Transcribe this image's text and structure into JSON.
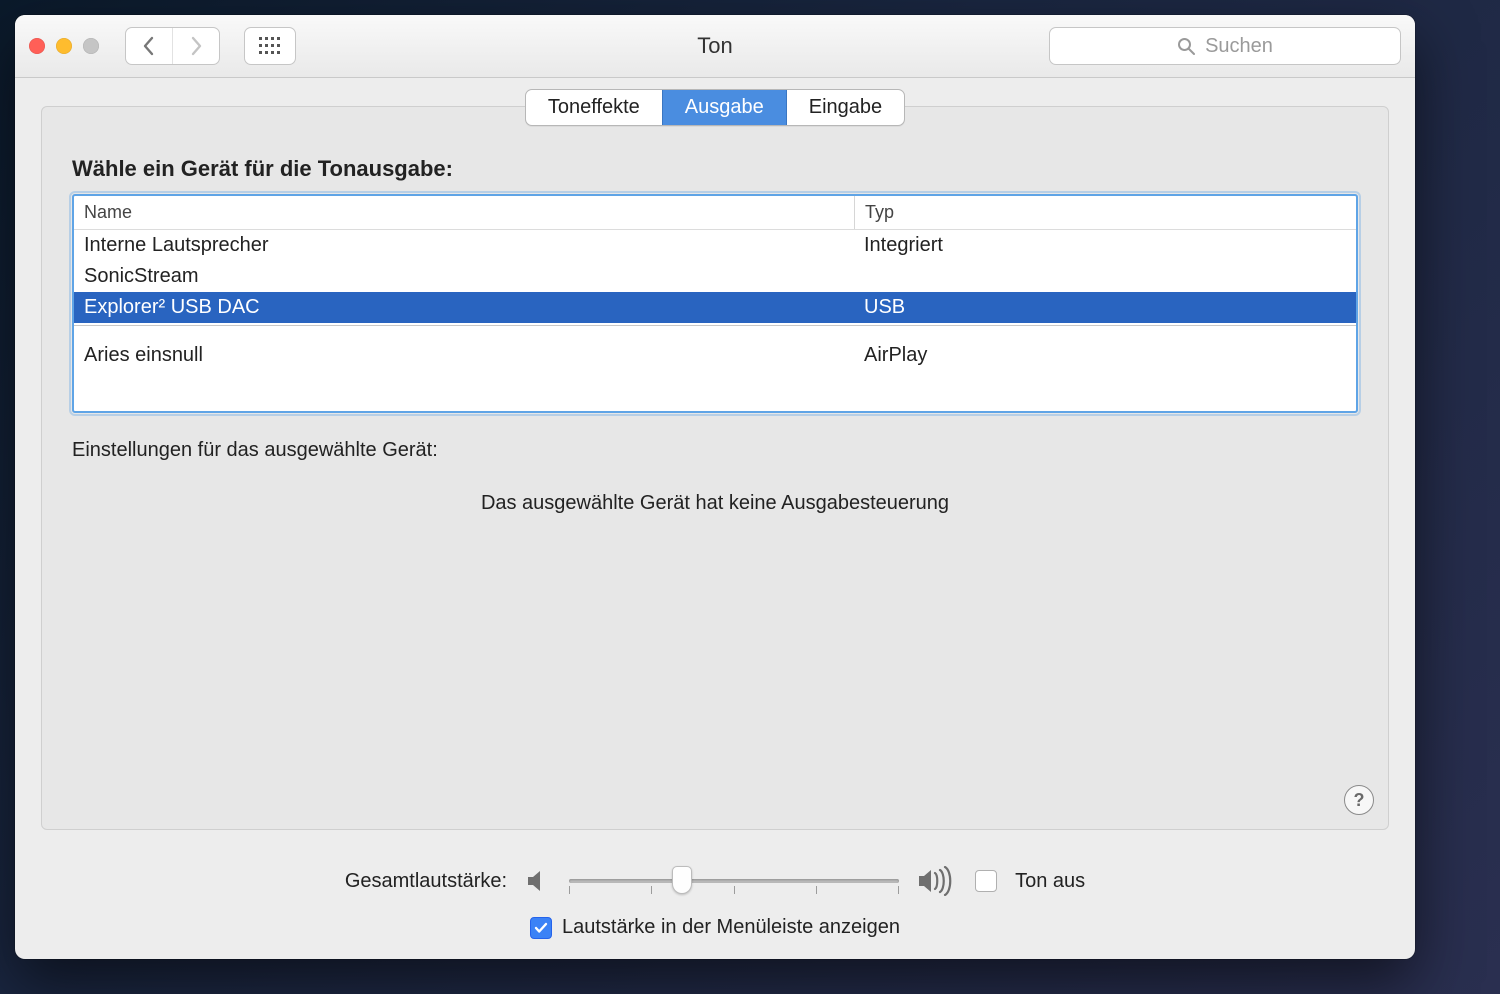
{
  "window": {
    "title": "Ton"
  },
  "search": {
    "placeholder": "Suchen"
  },
  "tabs": {
    "items": [
      "Toneffekte",
      "Ausgabe",
      "Eingabe"
    ],
    "active_index": 1
  },
  "heading": "Wähle ein Gerät für die Tonausgabe:",
  "columns": {
    "name": "Name",
    "type": "Typ"
  },
  "devices": [
    {
      "name": "Interne Lautsprecher",
      "type": "Integriert",
      "selected": false,
      "group": 0
    },
    {
      "name": "SonicStream",
      "type": "",
      "selected": false,
      "group": 0
    },
    {
      "name": "Explorer² USB DAC",
      "type": "USB",
      "selected": true,
      "group": 0
    },
    {
      "name": "Aries einsnull",
      "type": "AirPlay",
      "selected": false,
      "group": 1
    }
  ],
  "settings_label": "Einstellungen für das ausgewählte Gerät:",
  "no_controls": "Das ausgewählte Gerät hat keine Ausgabesteuerung",
  "volume": {
    "label": "Gesamtlautstärke:",
    "value_percent": 33,
    "mute_label": "Ton aus",
    "mute_checked": false,
    "menubar_label": "Lautstärke in der Menüleiste anzeigen",
    "menubar_checked": true
  },
  "icons": {
    "search": "search-icon",
    "back": "chevron-left-icon",
    "fwd": "chevron-right-icon",
    "grid": "apps-grid-icon",
    "speaker_low": "speaker-low-icon",
    "speaker_high": "speaker-high-icon",
    "help": "help-icon"
  }
}
